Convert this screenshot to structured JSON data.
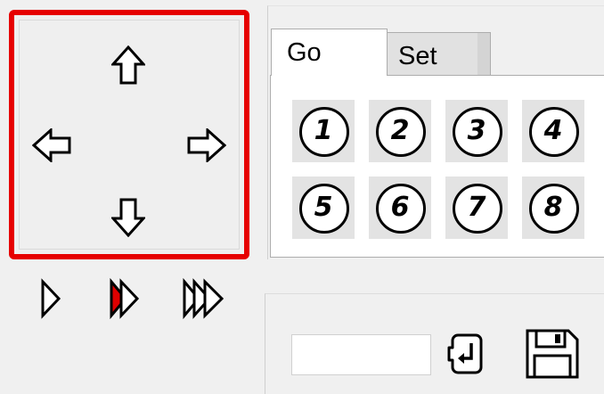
{
  "dpad": {
    "up_icon": "arrow-up-icon",
    "down_icon": "arrow-down-icon",
    "left_icon": "arrow-left-icon",
    "right_icon": "arrow-right-icon",
    "border_color": "#e60000"
  },
  "speed": [
    {
      "icon": "play-slow-icon"
    },
    {
      "icon": "play-medium-icon",
      "accent": "#e00000"
    },
    {
      "icon": "play-fast-icon"
    }
  ],
  "tabs": [
    {
      "label": "Go",
      "active": true
    },
    {
      "label": "Set",
      "active": false
    }
  ],
  "positions": [
    "1",
    "2",
    "3",
    "4",
    "5",
    "6",
    "7",
    "8"
  ],
  "value_input": {
    "value": "",
    "placeholder": ""
  },
  "tools": {
    "enter_icon": "enter-icon",
    "save_icon": "save-icon"
  }
}
